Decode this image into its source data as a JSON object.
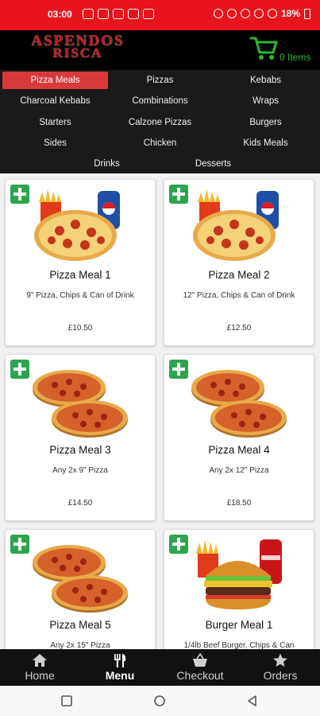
{
  "status_bar": {
    "time": "03:00",
    "battery": "18%"
  },
  "header": {
    "logo_line1": "ASPENDOS",
    "logo_line2": "RISCA",
    "cart_count": "0 Items",
    "accent_green": "#2eb82e"
  },
  "categories": [
    {
      "label": "Pizza Meals",
      "active": true
    },
    {
      "label": "Pizzas"
    },
    {
      "label": "Kebabs"
    },
    {
      "label": "Charcoal Kebabs"
    },
    {
      "label": "Combinations"
    },
    {
      "label": "Wraps"
    },
    {
      "label": "Starters"
    },
    {
      "label": "Calzone Pizzas"
    },
    {
      "label": "Burgers"
    },
    {
      "label": "Sides"
    },
    {
      "label": "Chicken"
    },
    {
      "label": "Kids Meals"
    },
    {
      "label": "Drinks"
    },
    {
      "label": "Desserts"
    }
  ],
  "products": [
    {
      "name": "Pizza Meal 1",
      "desc": "9\" Pizza, Chips & Can of Drink",
      "price": "£10.50",
      "image": "pizza-chips-drink"
    },
    {
      "name": "Pizza Meal 2",
      "desc": "12\" Pizza, Chips & Can of Drink",
      "price": "£12.50",
      "image": "pizza-chips-drink"
    },
    {
      "name": "Pizza Meal 3",
      "desc": "Any 2x 9\" Pizza",
      "price": "£14.50",
      "image": "two-pizzas"
    },
    {
      "name": "Pizza Meal 4",
      "desc": "Any 2x 12\" Pizza",
      "price": "£18.50",
      "image": "two-pizzas"
    },
    {
      "name": "Pizza Meal 5",
      "desc": "Any 2x 15\" Pizza",
      "price": "",
      "image": "two-pizzas"
    },
    {
      "name": "Burger Meal 1",
      "desc": "1/4lb Beef Burger, Chips & Can",
      "price": "",
      "image": "burger-chips-drink"
    }
  ],
  "bottom_nav": [
    {
      "label": "Home",
      "icon": "home-icon"
    },
    {
      "label": "Menu",
      "icon": "cutlery-icon",
      "active": true
    },
    {
      "label": "Checkout",
      "icon": "basket-icon"
    },
    {
      "label": "Orders",
      "icon": "star-icon"
    }
  ],
  "colors": {
    "status_red": "#e8141b",
    "active_category": "#d83a3a",
    "add_green": "#2ea44f"
  }
}
